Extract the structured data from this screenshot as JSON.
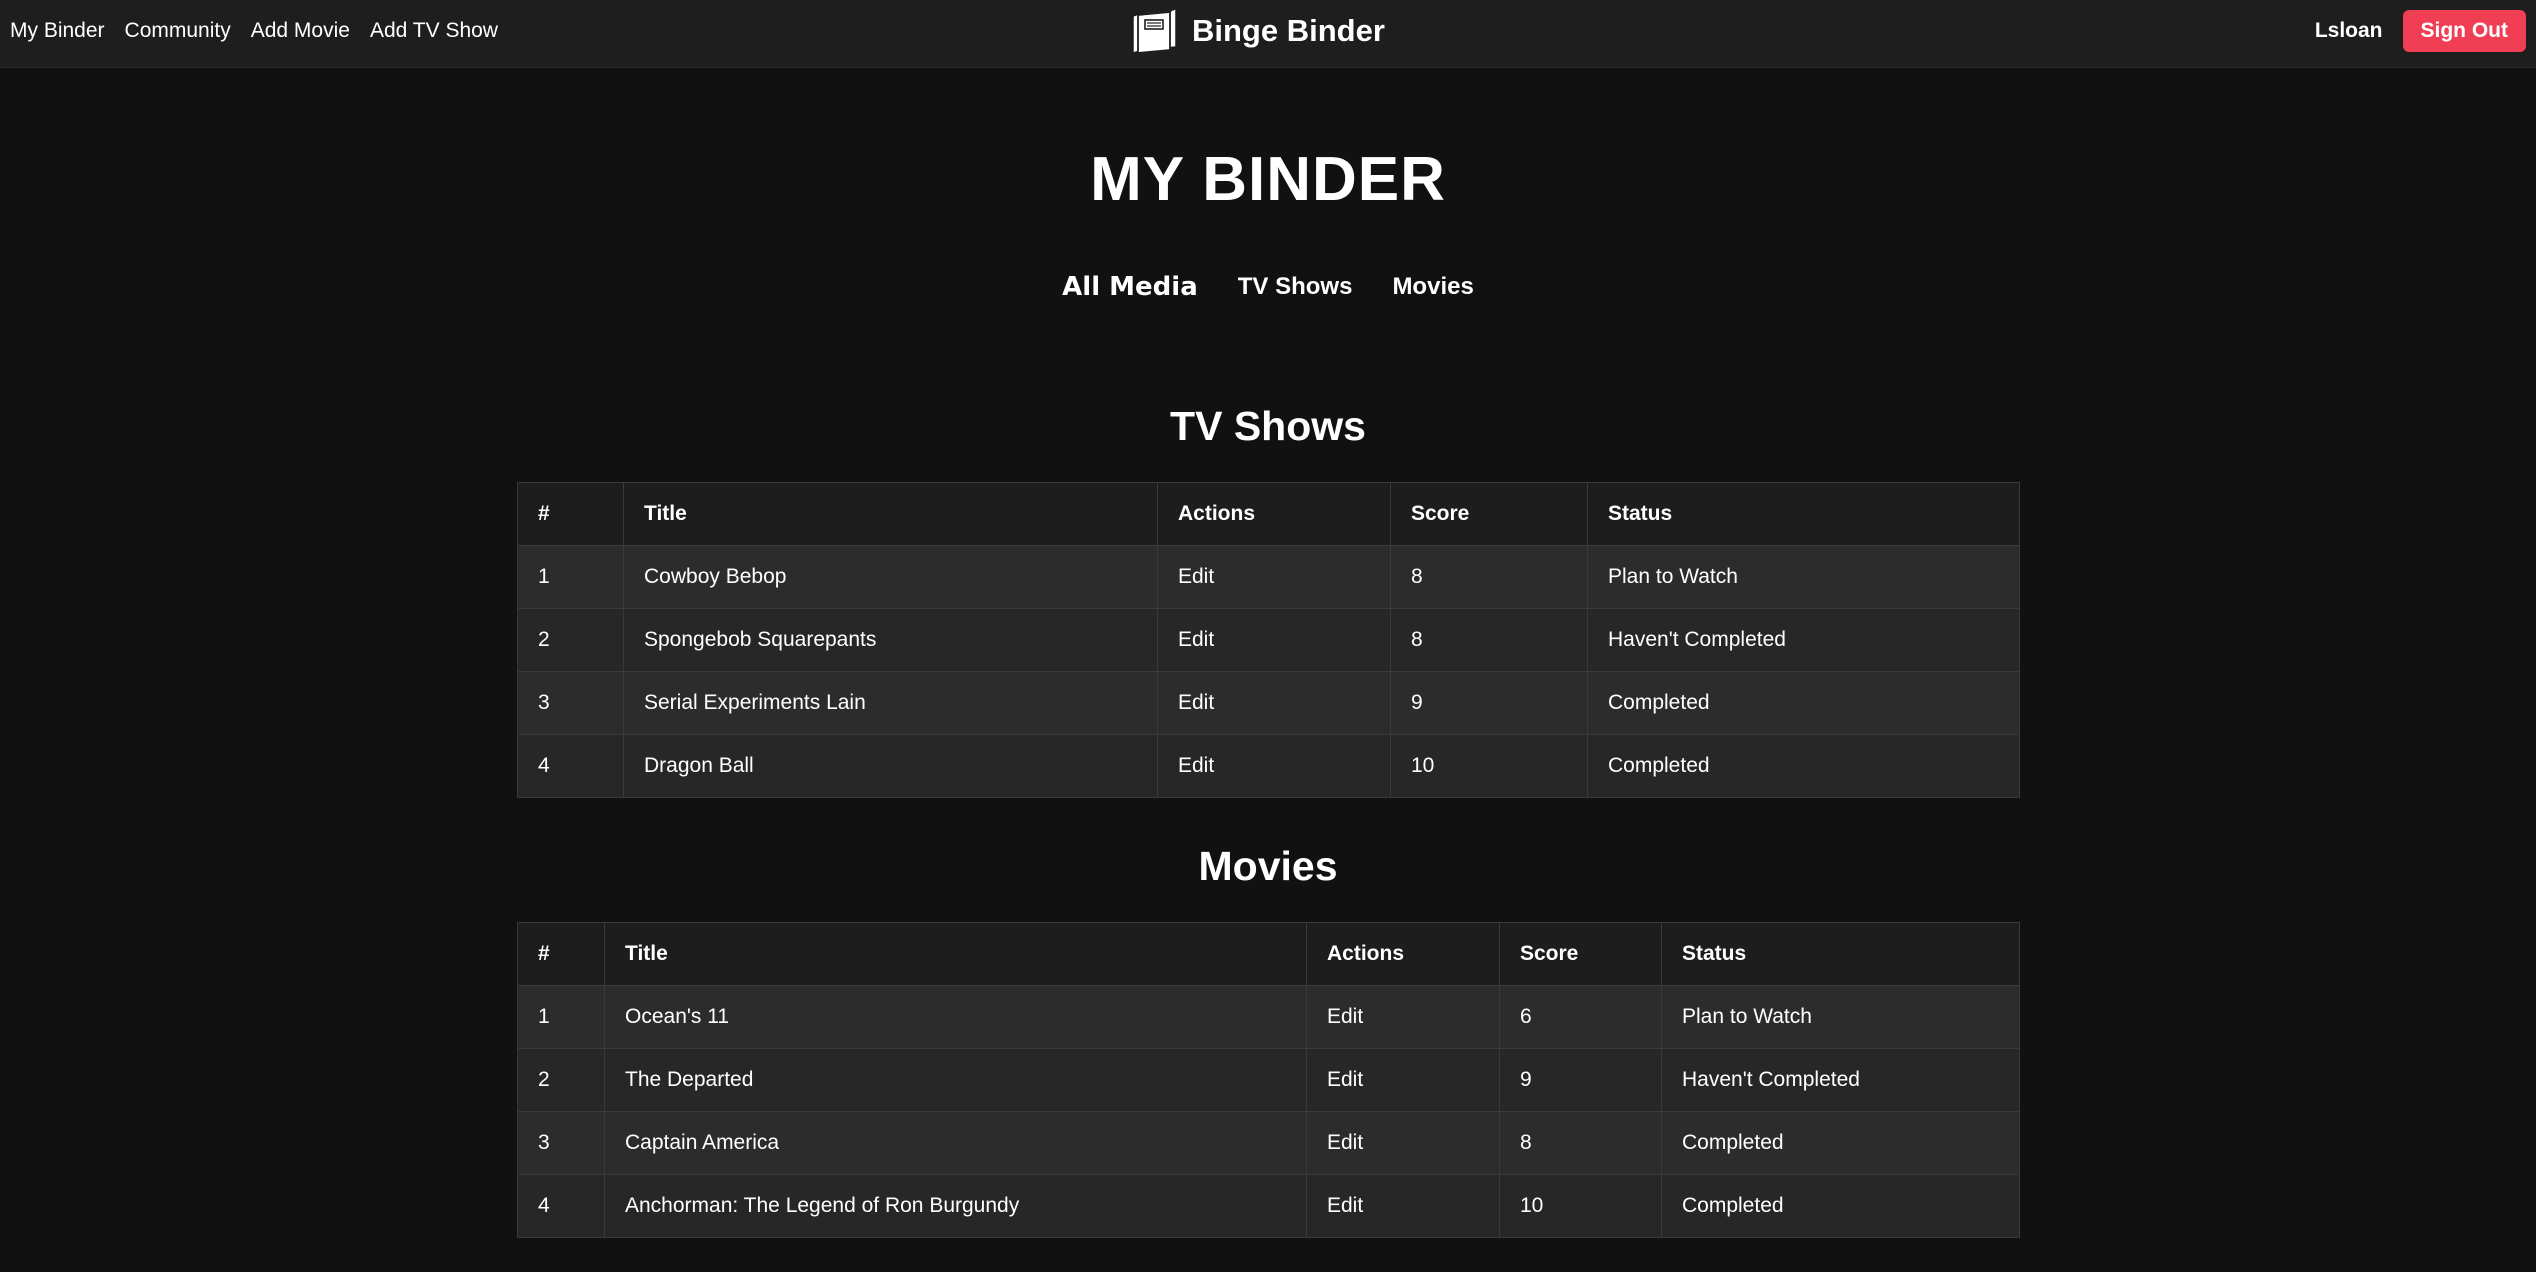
{
  "nav": {
    "links": [
      "My Binder",
      "Community",
      "Add Movie",
      "Add TV Show"
    ],
    "brand": "Binge Binder",
    "username": "Lsloan",
    "signout": "Sign Out"
  },
  "page": {
    "title": "MY BINDER",
    "tabs": [
      "All Media",
      "TV Shows",
      "Movies"
    ],
    "active_tab": "All Media"
  },
  "tv": {
    "heading": "TV Shows",
    "columns": [
      "#",
      "Title",
      "Actions",
      "Score",
      "Status"
    ],
    "rows": [
      {
        "num": "1",
        "title": "Cowboy Bebop",
        "action": "Edit",
        "score": "8",
        "status": "Plan to Watch"
      },
      {
        "num": "2",
        "title": "Spongebob Squarepants",
        "action": "Edit",
        "score": "8",
        "status": "Haven't Completed"
      },
      {
        "num": "3",
        "title": "Serial Experiments Lain",
        "action": "Edit",
        "score": "9",
        "status": "Completed"
      },
      {
        "num": "4",
        "title": "Dragon Ball",
        "action": "Edit",
        "score": "10",
        "status": "Completed"
      }
    ]
  },
  "movies": {
    "heading": "Movies",
    "columns": [
      "#",
      "Title",
      "Actions",
      "Score",
      "Status"
    ],
    "rows": [
      {
        "num": "1",
        "title": "Ocean's 11",
        "action": "Edit",
        "score": "6",
        "status": "Plan to Watch"
      },
      {
        "num": "2",
        "title": "The Departed",
        "action": "Edit",
        "score": "9",
        "status": "Haven't Completed"
      },
      {
        "num": "3",
        "title": "Captain America",
        "action": "Edit",
        "score": "8",
        "status": "Completed"
      },
      {
        "num": "4",
        "title": "Anchorman: The Legend of Ron Burgundy",
        "action": "Edit",
        "score": "10",
        "status": "Completed"
      }
    ]
  },
  "colors": {
    "background": "#111111",
    "navbar": "#1e1e1e",
    "signout": "#f03e54"
  },
  "icons": {
    "brand": "binder-icon"
  }
}
